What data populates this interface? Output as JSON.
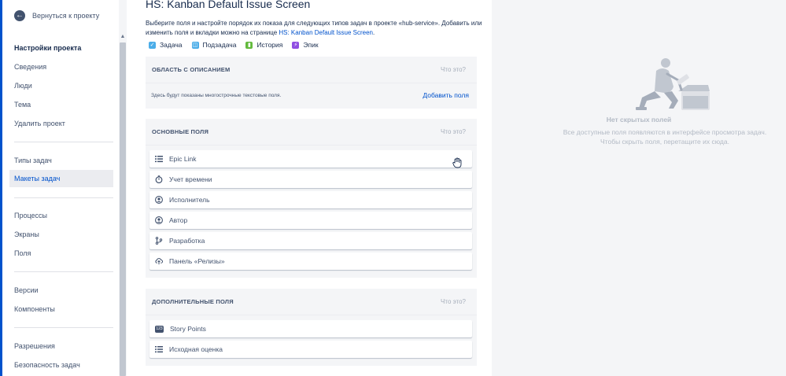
{
  "sidebar": {
    "back_label": "Вернуться к проекту",
    "heading": "Настройки проекта",
    "group1": [
      "Сведения",
      "Люди",
      "Тема",
      "Удалить проект"
    ],
    "group2": [
      "Типы задач",
      "Макеты задач"
    ],
    "group3": [
      "Процессы",
      "Экраны",
      "Поля"
    ],
    "group4": [
      "Версии",
      "Компоненты"
    ],
    "group5": [
      "Разрешения",
      "Безопасность задач"
    ],
    "active_item": "Макеты задач"
  },
  "main": {
    "title": "HS: Kanban Default Issue Screen",
    "desc_part1": "Выберите поля и настройте порядок их показа для следующих типов задач в проекте «hub-service». Добавить или изменить поля и вкладки можно на странице ",
    "desc_link": "HS: Kanban Default Issue Screen",
    "desc_part2": ".",
    "issue_types": [
      {
        "label": "Задача",
        "icon": "task-icon",
        "color": "#4bade8"
      },
      {
        "label": "Подзадача",
        "icon": "subtask-icon",
        "color": "#4bade8"
      },
      {
        "label": "История",
        "icon": "story-icon",
        "color": "#63ba3c"
      },
      {
        "label": "Эпик",
        "icon": "epic-icon",
        "color": "#904ee2"
      }
    ]
  },
  "description_section": {
    "title": "ОБЛАСТЬ С ОПИСАНИЕМ",
    "hint": "Что это?",
    "text": "Здесь будут показаны многострочные текстовые поля.",
    "add_label": "Добавить поля"
  },
  "main_section": {
    "title": "ОСНОВНЫЕ ПОЛЯ",
    "hint": "Что это?",
    "fields": [
      {
        "label": "Epic Link",
        "icon": "list-icon"
      },
      {
        "label": "Учет времени",
        "icon": "stopwatch-icon"
      },
      {
        "label": "Исполнитель",
        "icon": "user-icon"
      },
      {
        "label": "Автор",
        "icon": "user-icon"
      },
      {
        "label": "Разработка",
        "icon": "branch-icon"
      },
      {
        "label": "Панель «Релизы»",
        "icon": "cloud-upload-icon"
      }
    ]
  },
  "extra_section": {
    "title": "ДОПОЛНИТЕЛЬНЫЕ ПОЛЯ",
    "hint": "Что это?",
    "fields": [
      {
        "label": "Story Points",
        "icon": "number-badge-icon",
        "badge": "123"
      },
      {
        "label": "Исходная оценка",
        "icon": "list-icon"
      }
    ]
  },
  "hidden_panel": {
    "title": "Нет скрытых полей",
    "text": "Все доступные поля появляются в интерфейсе просмотра задач. Чтобы скрыть поля, перетащите их сюда."
  },
  "colors": {
    "accent": "#0052cc",
    "text": "#172b4d",
    "subtle": "#42526e",
    "panel_bg": "#f4f5f7"
  }
}
